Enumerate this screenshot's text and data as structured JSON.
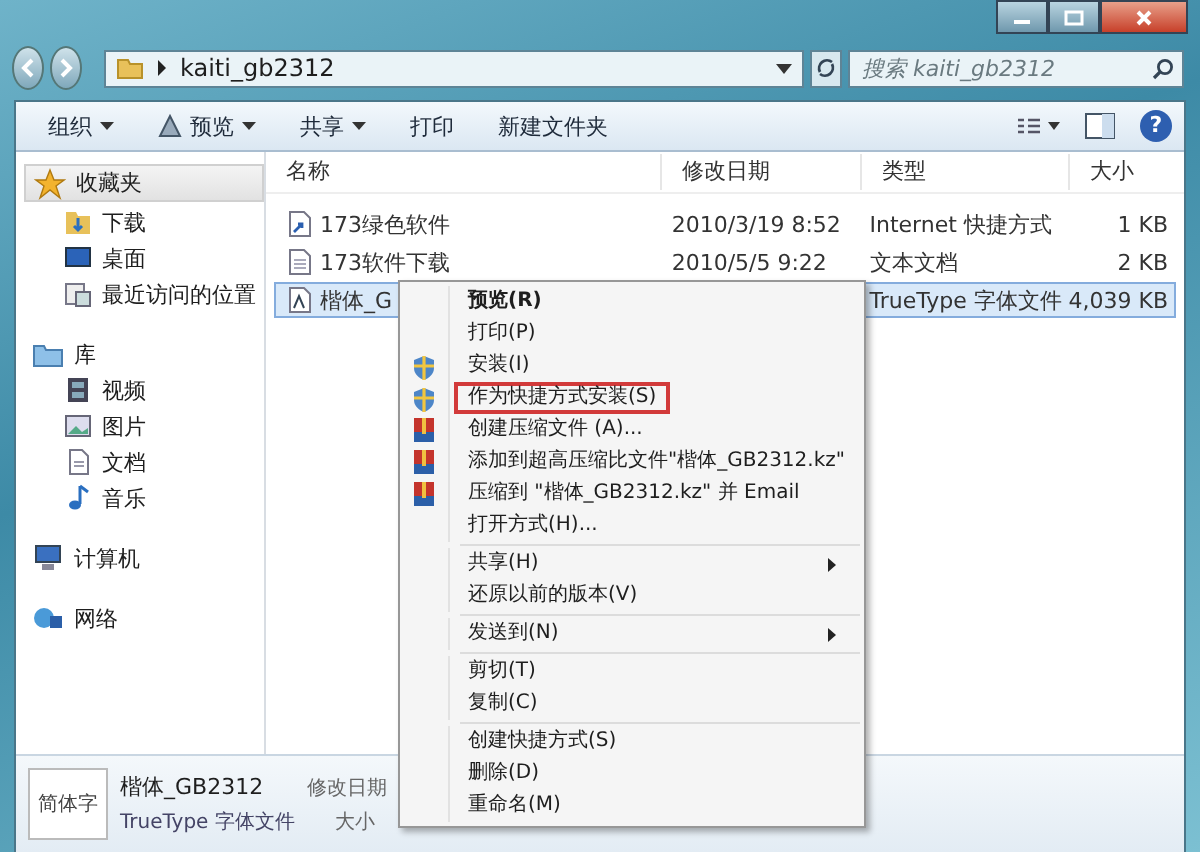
{
  "address_bar": {
    "path": "kaiti_gb2312"
  },
  "search": {
    "placeholder": "搜索 kaiti_gb2312"
  },
  "toolbar": [
    {
      "label": "组织",
      "dropdown": true
    },
    {
      "label": "预览",
      "dropdown": true
    },
    {
      "label": "共享",
      "dropdown": true
    },
    {
      "label": "打印",
      "dropdown": false
    },
    {
      "label": "新建文件夹",
      "dropdown": false
    }
  ],
  "help_button": "?",
  "sidebar": {
    "groups": [
      {
        "label": "收藏夹",
        "selected": true,
        "children": [
          {
            "label": "下载",
            "selected": false
          },
          {
            "label": "桌面",
            "selected": false
          },
          {
            "label": "最近访问的位置",
            "selected": false
          }
        ]
      },
      {
        "label": "库",
        "selected": false,
        "children": [
          {
            "label": "视频",
            "selected": false
          },
          {
            "label": "图片",
            "selected": false
          },
          {
            "label": "文档",
            "selected": false
          },
          {
            "label": "音乐",
            "selected": false
          }
        ]
      },
      {
        "label": "计算机",
        "selected": false
      },
      {
        "label": "网络",
        "selected": false
      }
    ]
  },
  "table": {
    "columns": [
      "名称",
      "修改日期",
      "类型",
      "大小"
    ],
    "rows": [
      {
        "kind": "shortcut",
        "name": "173绿色软件",
        "date": "2010/3/19 8:52",
        "type": "Internet 快捷方式",
        "size": "1 KB",
        "selected": false
      },
      {
        "kind": "text",
        "name": "173软件下载",
        "date": "2010/5/5 9:22",
        "type": "文本文档",
        "size": "2 KB",
        "selected": false
      },
      {
        "kind": "font",
        "name": "楷体_G",
        "type": "TrueType 字体文件",
        "size": "4,039 KB",
        "selected": true
      }
    ]
  },
  "context_menu": [
    {
      "kind": "plain",
      "label": "预览(R)",
      "bold": true,
      "submenu": false,
      "outlined": false
    },
    {
      "kind": "plain",
      "label": "打印(P)",
      "bold": false,
      "submenu": false,
      "outlined": false
    },
    {
      "kind": "shield",
      "label": "安装(I)",
      "bold": false,
      "submenu": false,
      "outlined": false
    },
    {
      "kind": "shield",
      "label": "作为快捷方式安装(S)",
      "bold": false,
      "submenu": false,
      "outlined": true
    },
    {
      "kind": "archive",
      "label": "创建压缩文件 (A)...",
      "bold": false,
      "submenu": false,
      "outlined": false
    },
    {
      "kind": "archive",
      "label": "添加到超高压缩比文件\"楷体_GB2312.kz\"",
      "bold": false,
      "submenu": false,
      "outlined": false
    },
    {
      "kind": "archive",
      "label": "压缩到 \"楷体_GB2312.kz\" 并 Email",
      "bold": false,
      "submenu": false,
      "outlined": false
    },
    {
      "kind": "plain",
      "label": "打开方式(H)...",
      "bold": false,
      "submenu": false,
      "outlined": false
    },
    {
      "kind": "separator"
    },
    {
      "kind": "plain",
      "label": "共享(H)",
      "bold": false,
      "submenu": true,
      "outlined": false
    },
    {
      "kind": "plain",
      "label": "还原以前的版本(V)",
      "bold": false,
      "submenu": false,
      "outlined": false
    },
    {
      "kind": "separator"
    },
    {
      "kind": "plain",
      "label": "发送到(N)",
      "bold": false,
      "submenu": true,
      "outlined": false
    },
    {
      "kind": "separator"
    },
    {
      "kind": "plain",
      "label": "剪切(T)",
      "bold": false,
      "submenu": false,
      "outlined": false
    },
    {
      "kind": "plain",
      "label": "复制(C)",
      "bold": false,
      "submenu": false,
      "outlined": false
    },
    {
      "kind": "separator"
    },
    {
      "kind": "plain",
      "label": "创建快捷方式(S)",
      "bold": false,
      "submenu": false,
      "outlined": false
    },
    {
      "kind": "plain",
      "label": "删除(D)",
      "bold": false,
      "submenu": false,
      "outlined": false
    },
    {
      "kind": "plain",
      "label": "重命名(M)",
      "bold": false,
      "submenu": false,
      "outlined": false
    }
  ],
  "details_pane": {
    "thumbnail_text": "简体字",
    "name": "楷体_GB2312",
    "type": "TrueType 字体文件",
    "date_label": "修改日期",
    "size_label": "大小"
  }
}
